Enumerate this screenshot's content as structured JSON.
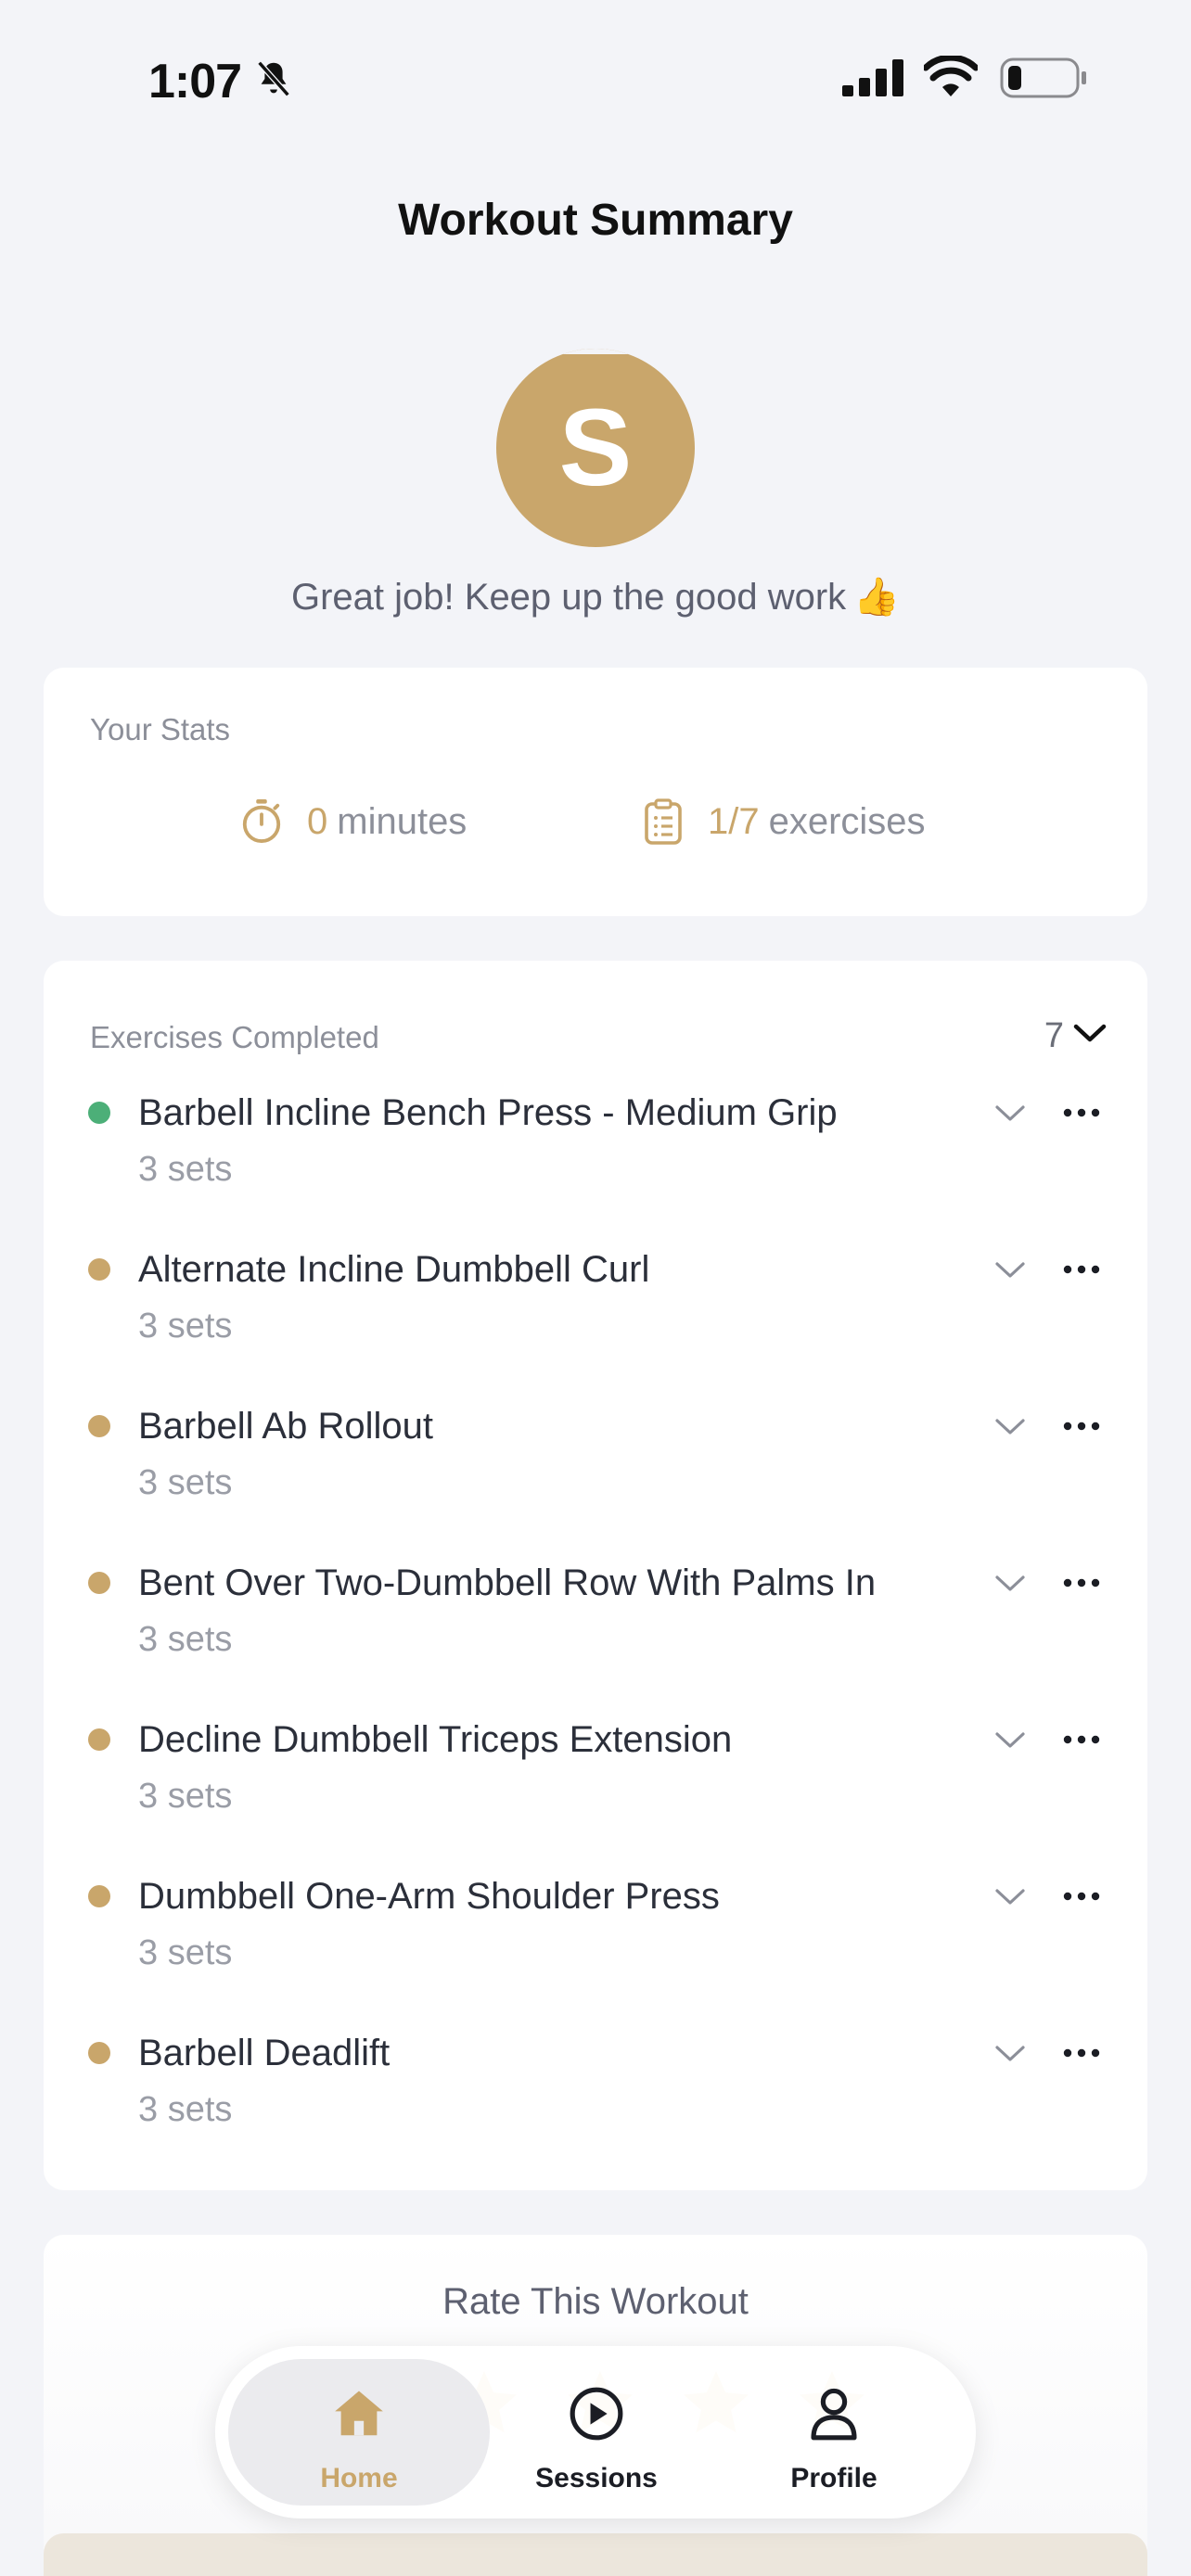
{
  "status_bar": {
    "time": "1:07"
  },
  "header": {
    "title": "Workout Summary"
  },
  "profile": {
    "avatar_letter": "S",
    "message": "Great job! Keep up the good work",
    "message_emoji": "👍"
  },
  "stats": {
    "label": "Your Stats",
    "minutes_value": "0",
    "minutes_unit": "minutes",
    "exercises_value": "1/7",
    "exercises_unit": "exercises"
  },
  "exercises": {
    "label": "Exercises Completed",
    "count": "7",
    "items": [
      {
        "name": "Barbell Incline Bench Press - Medium Grip",
        "sets": "3 sets",
        "status_color": "#4caf78"
      },
      {
        "name": "Alternate Incline Dumbbell Curl",
        "sets": "3 sets",
        "status_color": "#c9a66b"
      },
      {
        "name": "Barbell Ab Rollout",
        "sets": "3 sets",
        "status_color": "#c9a66b"
      },
      {
        "name": "Bent Over Two-Dumbbell Row With Palms In",
        "sets": "3 sets",
        "status_color": "#c9a66b"
      },
      {
        "name": "Decline Dumbbell Triceps Extension",
        "sets": "3 sets",
        "status_color": "#c9a66b"
      },
      {
        "name": "Dumbbell One-Arm Shoulder Press",
        "sets": "3 sets",
        "status_color": "#c9a66b"
      },
      {
        "name": "Barbell Deadlift",
        "sets": "3 sets",
        "status_color": "#c9a66b"
      }
    ]
  },
  "rating": {
    "title": "Rate This Workout",
    "stars": 5,
    "selected": 0
  },
  "tab_bar": {
    "tabs": [
      {
        "label": "Home",
        "icon": "home-icon",
        "active": true
      },
      {
        "label": "Sessions",
        "icon": "play-circle-icon",
        "active": false
      },
      {
        "label": "Profile",
        "icon": "person-icon",
        "active": false
      }
    ]
  },
  "colors": {
    "accent": "#c9a66b",
    "done": "#4caf78",
    "background": "#f3f4f8"
  }
}
